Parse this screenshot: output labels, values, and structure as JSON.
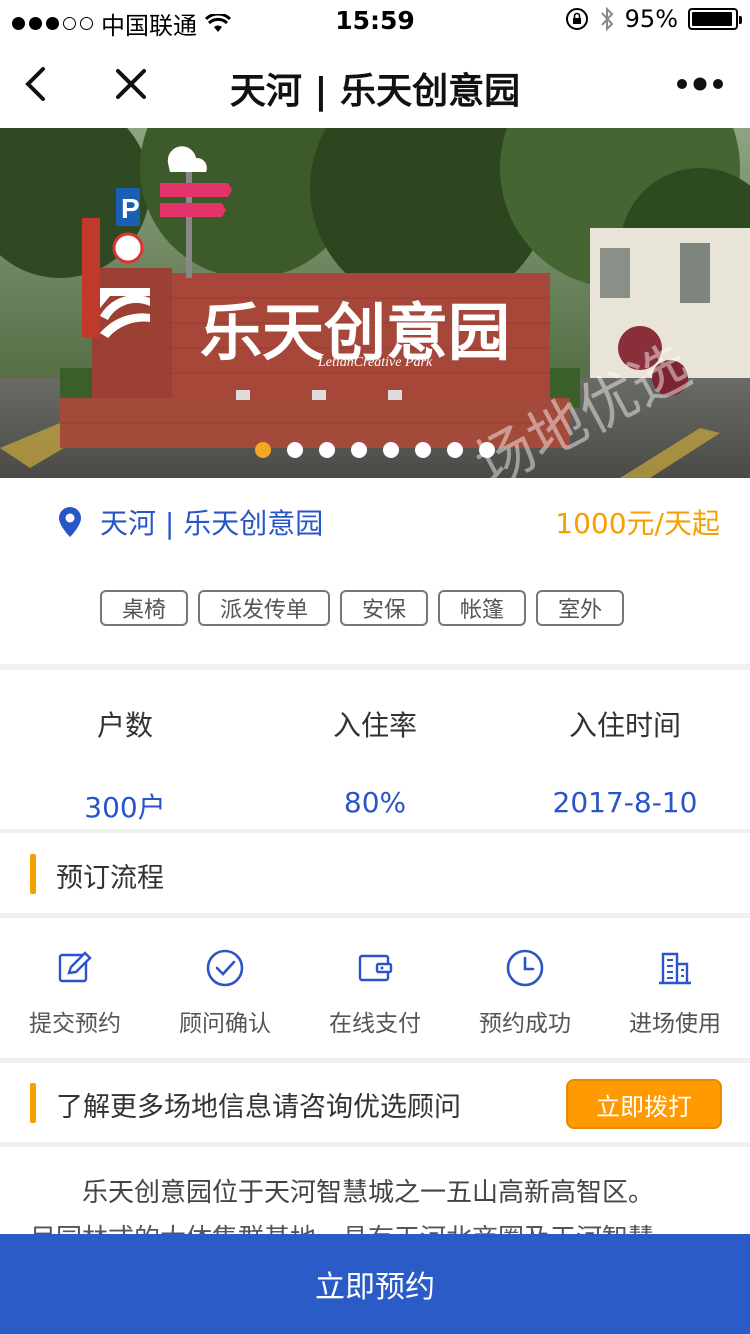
{
  "status_bar": {
    "carrier": "中国联通",
    "time": "15:59",
    "battery_percent": "95%",
    "battery_level": 0.95
  },
  "nav": {
    "title": "天河 | 乐天创意园"
  },
  "banner": {
    "sign_text": "乐天创意园",
    "sign_subtitle": "LetianCreative Park",
    "watermark": "场地优选",
    "page_count": 8,
    "active_page": 0
  },
  "venue": {
    "name": "天河 | 乐天创意园",
    "price": "1000元/天起",
    "tags": [
      "桌椅",
      "派发传单",
      "安保",
      "帐篷",
      "室外"
    ]
  },
  "stats": [
    {
      "label": "户数",
      "value": "300户"
    },
    {
      "label": "入住率",
      "value": "80%"
    },
    {
      "label": "入住时间",
      "value": "2017-8-10"
    }
  ],
  "booking_process": {
    "title": "预订流程",
    "steps": [
      {
        "label": "提交预约",
        "icon": "edit-icon"
      },
      {
        "label": "顾问确认",
        "icon": "check-circle-icon"
      },
      {
        "label": "在线支付",
        "icon": "wallet-icon"
      },
      {
        "label": "预约成功",
        "icon": "clock-icon"
      },
      {
        "label": "进场使用",
        "icon": "building-icon"
      }
    ]
  },
  "consult": {
    "text": "了解更多场地信息请咨询优选顾问",
    "button": "立即拨打"
  },
  "description": {
    "line1": "乐天创意园位于天河智慧城之一五山高新高智区。",
    "line2": "目园林式的大体集群基地，具有天河北商圈及天河智慧"
  },
  "bottom": {
    "book_button": "立即预约"
  },
  "colors": {
    "accent_blue": "#2a55c8",
    "accent_orange": "#f5a000",
    "book_bar": "#2b5bc6"
  }
}
